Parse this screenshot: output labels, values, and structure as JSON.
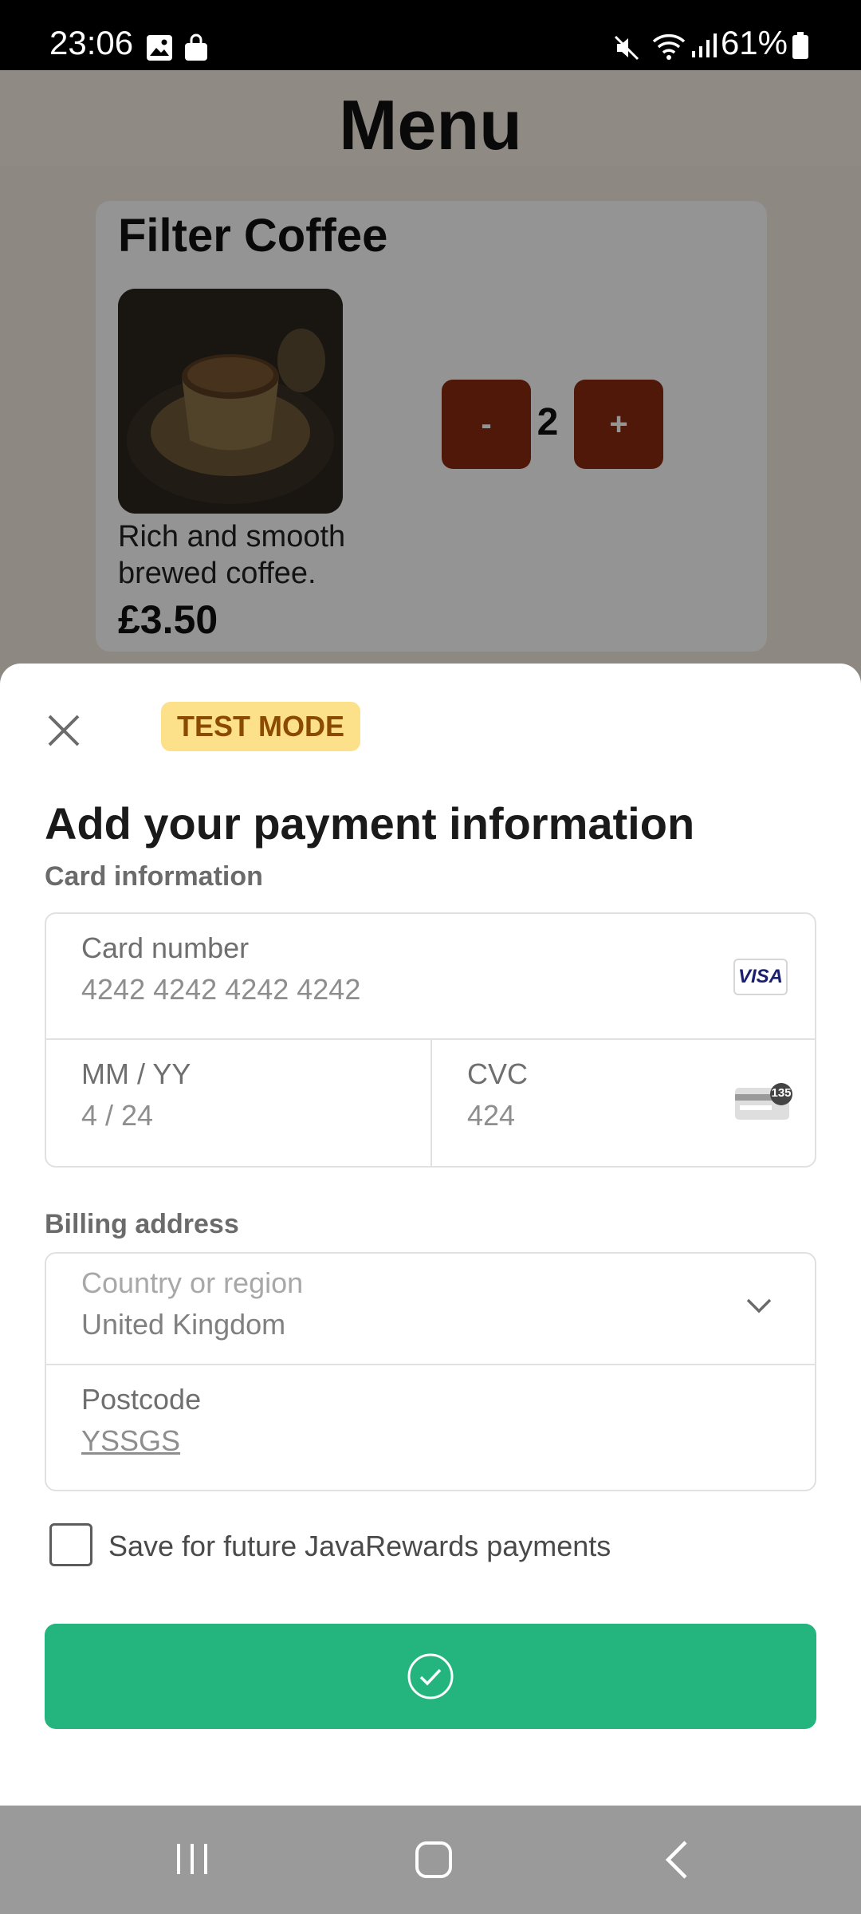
{
  "status_bar": {
    "time": "23:06",
    "battery": "61%",
    "icons": [
      "gallery-icon",
      "bag-icon",
      "mute-icon",
      "wifi-icon",
      "signal-icon",
      "battery-icon"
    ]
  },
  "app": {
    "title": "Menu",
    "product": {
      "name": "Filter Coffee",
      "description": "Rich and smooth brewed coffee.",
      "price": "£3.50",
      "quantity": "2",
      "decrement_label": "-",
      "increment_label": "+"
    }
  },
  "sheet": {
    "badge": "TEST MODE",
    "title": "Add your payment information",
    "card_section_label": "Card information",
    "card_number": {
      "label": "Card number",
      "value": "4242 4242 4242 4242",
      "brand": "VISA"
    },
    "expiry": {
      "label": "MM / YY",
      "value": "4 / 24"
    },
    "cvc": {
      "label": "CVC",
      "value": "424",
      "card_icon_text": "135"
    },
    "billing_section_label": "Billing address",
    "country": {
      "label": "Country or region",
      "value": "United Kingdom"
    },
    "postcode": {
      "label": "Postcode",
      "value": "YSSGS"
    },
    "save_label": "Save for future JavaRewards payments",
    "save_checked": false
  },
  "colors": {
    "accent": "#24b47e",
    "badge_bg": "#fde08a",
    "badge_text": "#8a4a00",
    "qty_button": "#8b2a10"
  }
}
